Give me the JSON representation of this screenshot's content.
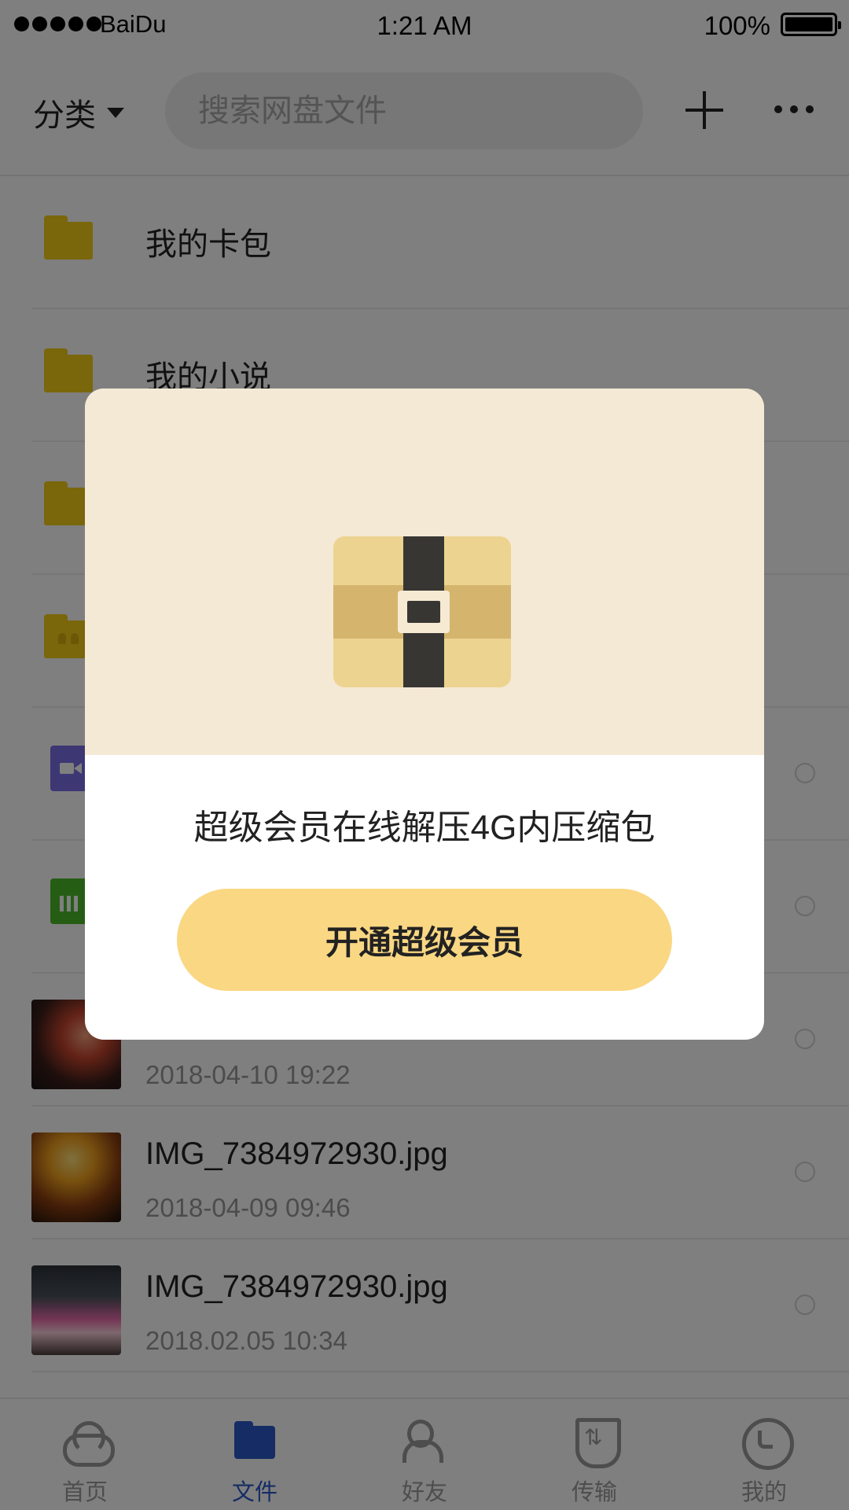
{
  "status_bar": {
    "carrier": "BaiDu",
    "time": "1:21 AM",
    "battery": "100%"
  },
  "header": {
    "category_label": "分类",
    "search_placeholder": "搜索网盘文件"
  },
  "files": [
    {
      "name": "我的卡包",
      "date": ""
    },
    {
      "name": "我的小说",
      "date": ""
    },
    {
      "name": "",
      "date": ""
    },
    {
      "name": "",
      "date": ""
    },
    {
      "name": "",
      "date": ""
    },
    {
      "name": "",
      "date": ""
    },
    {
      "name": "",
      "date": "2018-04-10   19:22"
    },
    {
      "name": "IMG_7384972930.jpg",
      "date": "2018-04-09   09:46"
    },
    {
      "name": "IMG_7384972930.jpg",
      "date": "2018.02.05   10:34"
    }
  ],
  "dialog": {
    "message": "超级会员在线解压4G内压缩包",
    "button_label": "开通超级会员"
  },
  "tabs": [
    {
      "label": "首页",
      "icon": "cloud-icon",
      "active": false
    },
    {
      "label": "文件",
      "icon": "folder-icon",
      "active": true
    },
    {
      "label": "好友",
      "icon": "friends-icon",
      "active": false
    },
    {
      "label": "传输",
      "icon": "transfer-icon",
      "active": false
    },
    {
      "label": "我的",
      "icon": "profile-icon",
      "active": false
    }
  ],
  "colors": {
    "accent": "#2a59c8",
    "folder": "#f5cd17",
    "cta": "#fad783",
    "dialog_header": "#f4e9d5"
  }
}
